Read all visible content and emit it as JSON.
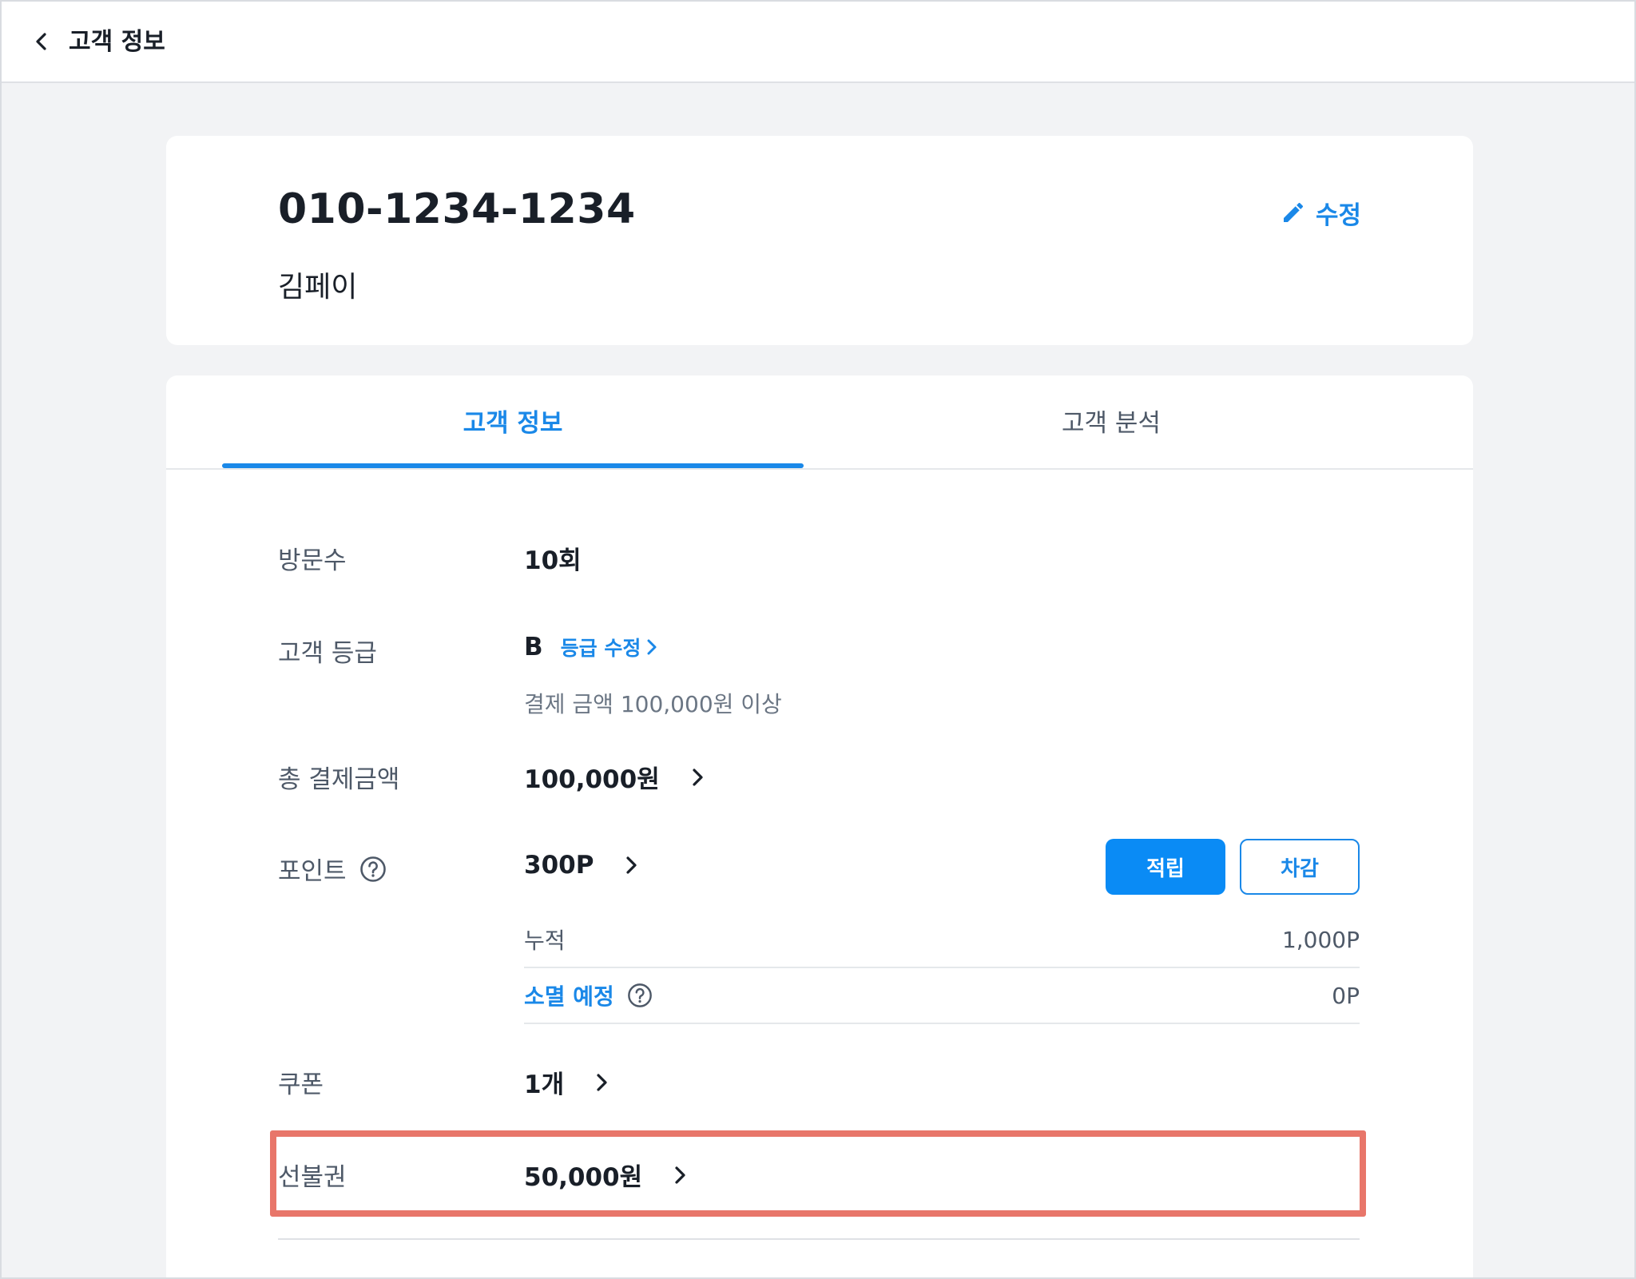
{
  "topbar": {
    "title": "고객 정보"
  },
  "customer": {
    "phone": "010-1234-1234",
    "name": "김페이",
    "edit_label": "수정"
  },
  "tabs": [
    {
      "label": "고객 정보",
      "active": true
    },
    {
      "label": "고객 분석",
      "active": false
    }
  ],
  "info": {
    "visits": {
      "label": "방문수",
      "value": "10회"
    },
    "grade": {
      "label": "고객 등급",
      "value": "B",
      "edit_label": "등급 수정",
      "note": "결제 금액 100,000원 이상"
    },
    "total": {
      "label": "총 결제금액",
      "value": "100,000원"
    },
    "points": {
      "label": "포인트",
      "value": "300P",
      "earn_label": "적립",
      "deduct_label": "차감",
      "accumulated_label": "누적",
      "accumulated_value": "1,000P",
      "expiring_label": "소멸 예정",
      "expiring_value": "0P"
    },
    "coupon": {
      "label": "쿠폰",
      "value": "1개"
    },
    "prepaid": {
      "label": "선불권",
      "value": "50,000원"
    }
  },
  "colors": {
    "accent": "#1a88e8",
    "primary_button": "#0a8bf5",
    "highlight": "#e8766a"
  }
}
